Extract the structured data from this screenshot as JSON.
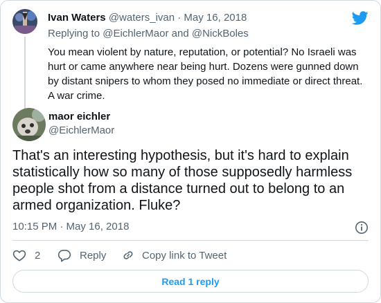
{
  "parent_tweet": {
    "name": "Ivan Waters",
    "handle_date": "@waters_ivan · May 16, 2018",
    "replying_prefix": "Replying to ",
    "replying_to_1": "@EichlerMaor",
    "replying_and": " and ",
    "replying_to_2": "@NickBoles",
    "line1": "You mean violent by nature, reputation, or potential?  No Israeli was",
    "line2": "hurt or came anywhere near being hurt. Dozens were gunned down",
    "line3": "by distant snipers to whom they posed no immediate or direct threat.",
    "line4": "A war crime."
  },
  "main_tweet": {
    "name": "maor eichler",
    "handle": "@EichlerMaor",
    "line1": "That's an interesting hypothesis, but it's hard to explain",
    "line2": "statistically how so many of those supposedly harmless",
    "line3": "people shot from a distance turned out to belong to an",
    "line4": "armed organization. Fluke?",
    "timestamp": "10:15 PM · May 16, 2018"
  },
  "actions": {
    "like_count": "2",
    "reply_label": "Reply",
    "copy_label": "Copy link to Tweet"
  },
  "read_replies_label": "Read 1 reply",
  "colors": {
    "accent": "#1d9bf0",
    "muted": "#536471",
    "border": "#cfd9de"
  }
}
